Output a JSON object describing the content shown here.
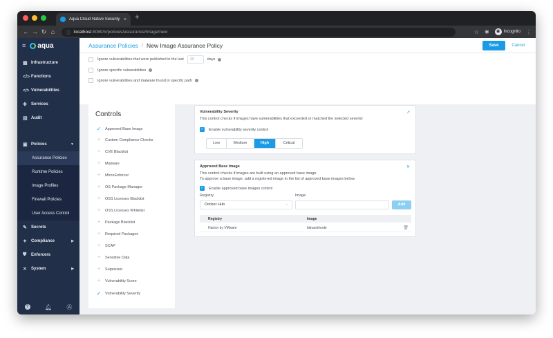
{
  "browser": {
    "tab_title": "Aqua Cloud Native Security Plat",
    "tab_close": "×",
    "new_tab": "+",
    "url_host": "localhost",
    "url_path": ":8080/#/policies/assurance/image/new",
    "incognito_label": "Incognito",
    "dot_colors": [
      "#ff5f57",
      "#febc2e",
      "#28c840"
    ]
  },
  "sidebar": {
    "logo_text": "aqua",
    "nav": [
      {
        "label": "Infrastructure",
        "icon": "▦"
      },
      {
        "label": "Functions",
        "icon": "</>"
      },
      {
        "label": "Vulnerabilities",
        "icon": "<⁄>"
      },
      {
        "label": "Services",
        "icon": "✚"
      },
      {
        "label": "Audit",
        "icon": "▤"
      }
    ],
    "policies": {
      "label": "Policies",
      "icon": "▣"
    },
    "policy_items": [
      {
        "label": "Assurance Policies",
        "active": true
      },
      {
        "label": "Runtime Policies"
      },
      {
        "label": "Image Profiles"
      },
      {
        "label": "Firewall Policies"
      },
      {
        "label": "User Access Control"
      }
    ],
    "bottom_nav": [
      {
        "label": "Secrets",
        "icon": "✎"
      },
      {
        "label": "Compliance",
        "icon": "✦"
      },
      {
        "label": "Enforcers",
        "icon": "⛊"
      },
      {
        "label": "System",
        "icon": "✕"
      }
    ]
  },
  "header": {
    "breadcrumb_link": "Assurance Policies",
    "breadcrumb_sep": "/",
    "breadcrumb_current": "New Image Assurance Policy",
    "save_label": "Save",
    "cancel_label": "Cancel"
  },
  "settings": {
    "published_prefix": "Ignore vulnerabilities that were published in the last",
    "published_value": "30",
    "published_suffix": "days",
    "ignore_specific": "Ignore specific vulnerabilities",
    "ignore_path": "Ignore vulnerabilities and malware found in specific path"
  },
  "controls": {
    "title": "Controls",
    "items": [
      {
        "label": "Approved Base Image",
        "enabled": true
      },
      {
        "label": "Custom Compliance Checks",
        "enabled": false
      },
      {
        "label": "CVE Blacklist",
        "enabled": false
      },
      {
        "label": "Malware",
        "enabled": false
      },
      {
        "label": "MicroEnforcer",
        "enabled": false
      },
      {
        "label": "OS Package Manager",
        "enabled": false
      },
      {
        "label": "OSS Licenses Blacklist",
        "enabled": false
      },
      {
        "label": "OSS Licenses Whitelist",
        "enabled": false
      },
      {
        "label": "Package Blacklist",
        "enabled": false
      },
      {
        "label": "Required Packages",
        "enabled": false
      },
      {
        "label": "SCAP",
        "enabled": false
      },
      {
        "label": "Sensitive Data",
        "enabled": false
      },
      {
        "label": "Superuser",
        "enabled": false
      },
      {
        "label": "Vulnerability Score",
        "enabled": false
      },
      {
        "label": "Vulnerability Severity",
        "enabled": true
      }
    ]
  },
  "severity_card": {
    "title": "Vulnerability Severity",
    "description": "This control checks if images have vulnerabilities that exceeded or matched the selected severity",
    "enable_label": "Enable vulnerability severity control",
    "options": [
      "Low",
      "Medium",
      "High",
      "Critical"
    ],
    "selected": "High"
  },
  "base_image_card": {
    "title": "Approved Base Image",
    "desc_line1": "This control checks if images are built using an approved base image.",
    "desc_line2": "To approve a base image, add a registered image to the list of approved base images below.",
    "enable_label": "Enable approved base images control",
    "registry_label": "Registry",
    "image_label": "Image",
    "registry_value": "Docker Hub",
    "add_label": "Add",
    "table_headers": [
      "Registry",
      "Image"
    ],
    "rows": [
      {
        "registry": "Harbor by VMware",
        "image": "bitnami/node"
      }
    ]
  },
  "colors": {
    "accent": "#1a9be6",
    "sidebar_bg": "#222f48"
  }
}
